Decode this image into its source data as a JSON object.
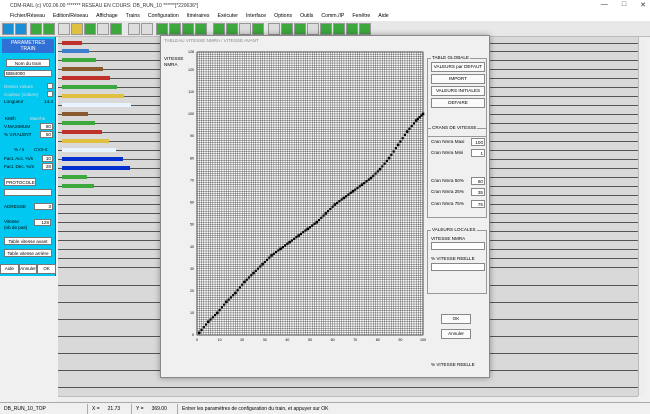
{
  "window": {
    "title": "CDM-RAIL (c) V02.06.00        ******* RESEAU EN COURS: DB_RUN_10 ******[*220636*]",
    "minimize": "—",
    "maximize": "□",
    "close": "✕"
  },
  "menu": [
    "Fichier/Réseau",
    "Edition/Réseau",
    "Affichage",
    "Trains",
    "Configuration",
    "Itinéraires",
    "Exécuter",
    "Interface",
    "Options",
    "Outils",
    "Comm./IP",
    "Fenêtre",
    "Aide"
  ],
  "left_panel": {
    "header": "PARAMETRES\nTRAIN",
    "train_name_button": "Nom du train",
    "train_name_value": "BB64000",
    "dessin_voiture": "Dessin voiture",
    "couleur": "Couleur (voiture)",
    "longueur_label": "Longueur",
    "longueur_value": "14.4",
    "kmh_label": "KM/h",
    "kmh_alt": "Marche",
    "vmax_label": "V.MAXIMUM",
    "vmax_value": "80",
    "vral_label": "% V.RALENT",
    "vral_value": "50",
    "pct_label": "% / s",
    "cv_label": "CV3-4",
    "facc_label": "Fact. Acc. %/s",
    "facc_value": "10",
    "fdec_label": "Fact. Dec. %/s",
    "fdec_value": "28",
    "protocole": "PROTOCOLE",
    "adresse_label": "ADRESSE",
    "adresse_value": "3",
    "vitesse_label": "Vitesse\n(nb de pas)",
    "vitesse_value": "128",
    "table_avant": "Table vitesse avant",
    "table_arriere": "Table vitesse arrière",
    "aide": "Aide",
    "annuler": "Annuler",
    "ok": "OK"
  },
  "dialog": {
    "title": "TABLEAU VITESSE NMRA / VITESSE AVANT",
    "ylabel": "VITESSE\nNMRA",
    "xlabel": "% VITESSE REELLE",
    "table_globale": "TABLE GLOBALE",
    "valeurs_defaut": "VALEURS par DEFAUT",
    "import": "IMPORT",
    "valeurs_initiales": "VALEURS INITIALES",
    "defaire": "DEFAIRE",
    "crans_vitesse": "CRANS DE VITESSE",
    "cran_maxi_label": "Cran Nmra Maxi",
    "cran_maxi_value": "100",
    "cran_mini_label": "Cran Nmra Mini",
    "cran_mini_value": "1",
    "cran50_label": "Cran Nmra 50%",
    "cran50_value": "60",
    "cran25_label": "Cran Nmra 25%",
    "cran25_value": "35",
    "cran75_label": "Cran Nmra 75%",
    "cran75_value": "75",
    "valeurs_locales": "VALEURS LOCALES",
    "vitesse_nmra": "VITESSE NMRA",
    "pct_vitesse_reelle": "% VITESSE REELLE",
    "ok": "OK",
    "annuler": "Annuler"
  },
  "status": {
    "network": "DB_RUN_10_TOP",
    "x_label": "X =",
    "x_value": "21.73",
    "y_label": "Y =",
    "y_value": "369.00",
    "message": "Entrer les paramètres de configuration du train, et appuyer sur OK"
  },
  "chart_data": {
    "type": "scatter",
    "xlabel": "% VITESSE REELLE",
    "ylabel": "VITESSE NMRA",
    "xlim": [
      0,
      100
    ],
    "ylim": [
      0,
      128
    ],
    "xticks": [
      0,
      10,
      20,
      30,
      40,
      50,
      60,
      70,
      80,
      90,
      100
    ],
    "yticks": [
      0,
      10,
      20,
      30,
      40,
      50,
      60,
      70,
      80,
      90,
      100,
      110,
      120,
      128
    ],
    "grid": true,
    "x": [
      1,
      5,
      9,
      13,
      17,
      21,
      25,
      29,
      33,
      37,
      41,
      45,
      49,
      53,
      57,
      61,
      65,
      69,
      73,
      77,
      81,
      85,
      89,
      93,
      97,
      100
    ],
    "y": [
      1,
      6,
      10,
      15,
      19,
      24,
      28,
      32,
      36,
      39,
      42,
      45,
      48,
      51,
      55,
      59,
      62,
      65,
      68,
      71,
      75,
      80,
      86,
      92,
      97,
      100
    ]
  }
}
